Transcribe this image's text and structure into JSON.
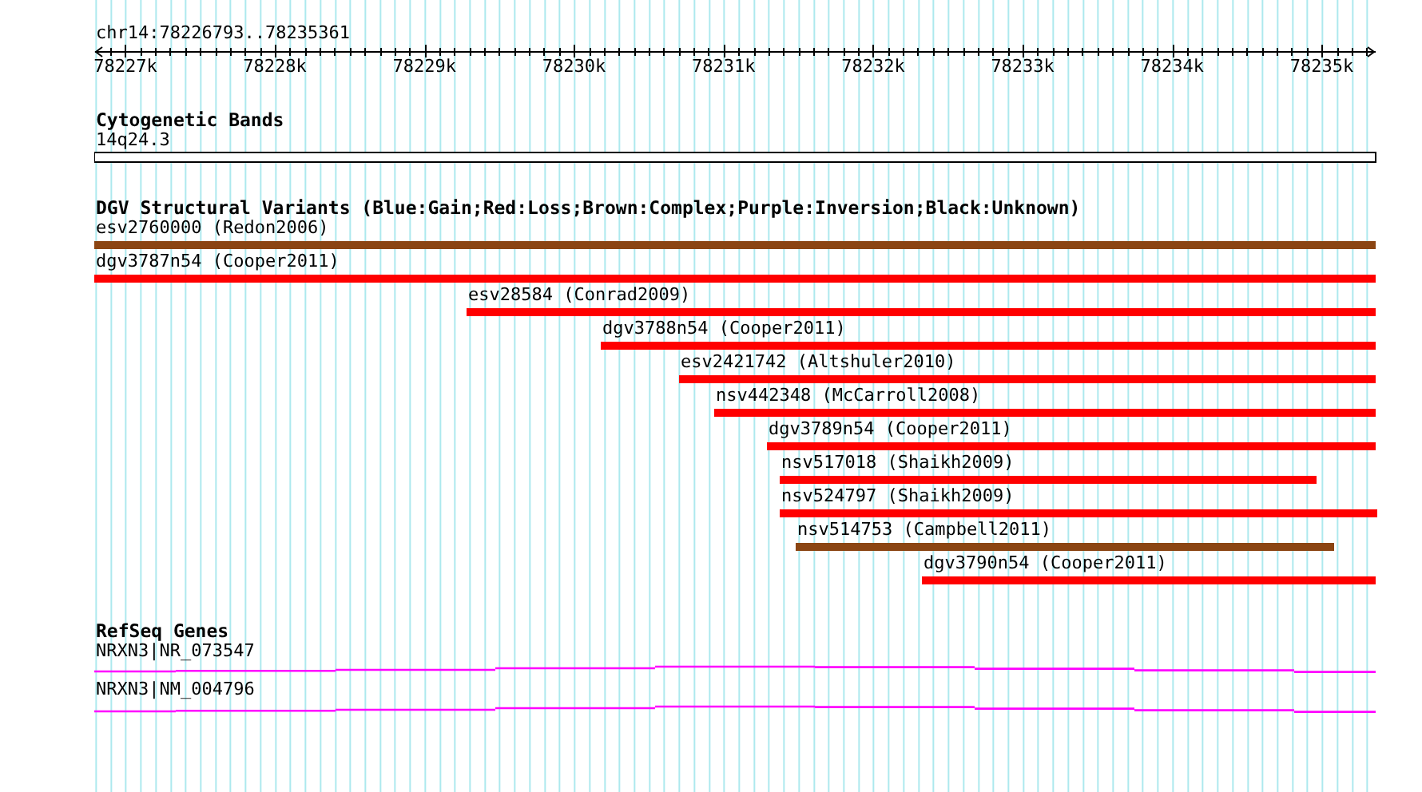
{
  "ruler": {
    "region": "chr14:78226793..78235361",
    "ticks": [
      "78227k",
      "78228k",
      "78229k",
      "78230k",
      "78231k",
      "78232k",
      "78233k",
      "78234k",
      "78235k"
    ]
  },
  "tracks": [
    {
      "kind": "cytoband",
      "title": "Cytogenetic Bands",
      "features": [
        {
          "label": "14q24.3"
        }
      ]
    },
    {
      "kind": "variants",
      "title": "DGV Structural Variants (Blue:Gain;Red:Loss;Brown:Complex;Purple:Inversion;Black:Unknown)",
      "features": [
        {
          "label": "esv2760000 (Redon2006)",
          "color": "#8b4513"
        },
        {
          "label": "dgv3787n54 (Cooper2011)",
          "color": "#ff0000"
        },
        {
          "label": "esv28584 (Conrad2009)",
          "color": "#ff0000"
        },
        {
          "label": "dgv3788n54 (Cooper2011)",
          "color": "#ff0000"
        },
        {
          "label": "esv2421742 (Altshuler2010)",
          "color": "#ff0000"
        },
        {
          "label": "nsv442348 (McCarroll2008)",
          "color": "#ff0000"
        },
        {
          "label": "dgv3789n54 (Cooper2011)",
          "color": "#ff0000"
        },
        {
          "label": "nsv517018 (Shaikh2009)",
          "color": "#ff0000"
        },
        {
          "label": "nsv524797 (Shaikh2009)",
          "color": "#ff0000"
        },
        {
          "label": "nsv514753 (Campbell2011)",
          "color": "#8b4513"
        },
        {
          "label": "dgv3790n54 (Cooper2011)",
          "color": "#ff0000"
        }
      ]
    },
    {
      "kind": "genes",
      "title": "RefSeq Genes",
      "features": [
        {
          "label": "NRXN3|NR_073547"
        },
        {
          "label": "NRXN3|NM_004796"
        }
      ]
    }
  ]
}
